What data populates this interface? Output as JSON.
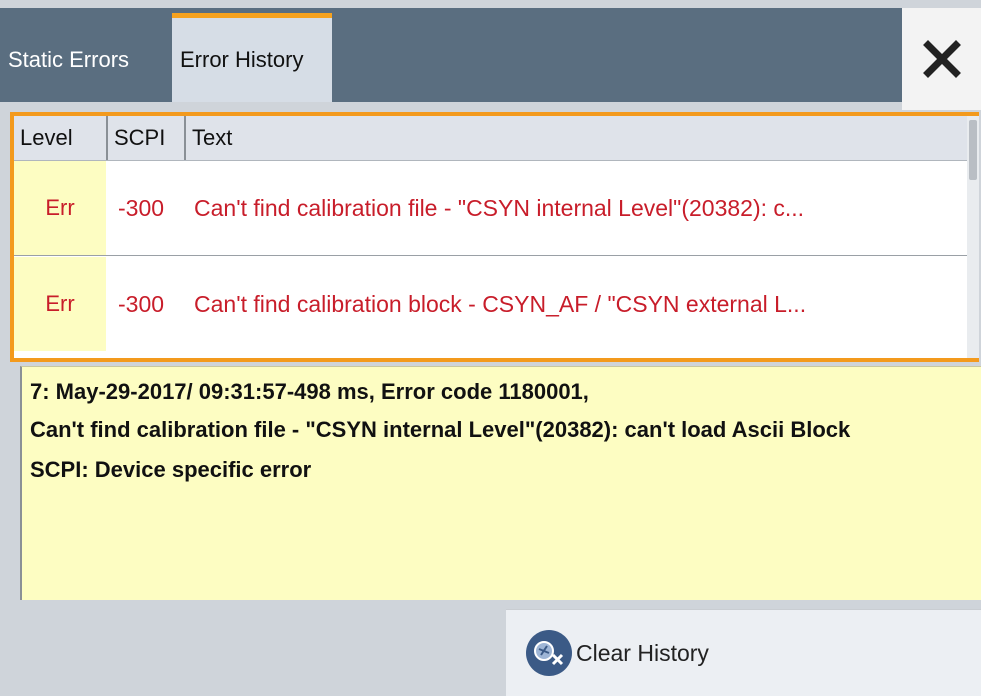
{
  "tabs": [
    {
      "label": "Static Errors",
      "active": false
    },
    {
      "label": "Error History",
      "active": true
    }
  ],
  "close_icon": "close-icon",
  "table": {
    "headers": [
      "Level",
      "SCPI",
      "Text"
    ],
    "rows": [
      {
        "level": "Err",
        "scpi": "-300",
        "text": "Can't find calibration file - \"CSYN internal Level\"(20382): c..."
      },
      {
        "level": "Err",
        "scpi": "-300",
        "text": "Can't find calibration block - CSYN_AF / \"CSYN external L..."
      }
    ]
  },
  "detail": {
    "line1": "7: May-29-2017/ 09:31:57-498 ms, Error code 1180001,",
    "line2": "Can't find calibration file - \"CSYN internal Level\"(20382): can't load Ascii Block",
    "line3": "SCPI: Device specific error"
  },
  "clear_button": {
    "label": "Clear History",
    "icon": "clear-history-icon"
  },
  "colors": {
    "accent": "#f39a1d",
    "error_text": "#c81d2a",
    "highlight": "#fdfdc2",
    "tabbar": "#5a6e80"
  }
}
